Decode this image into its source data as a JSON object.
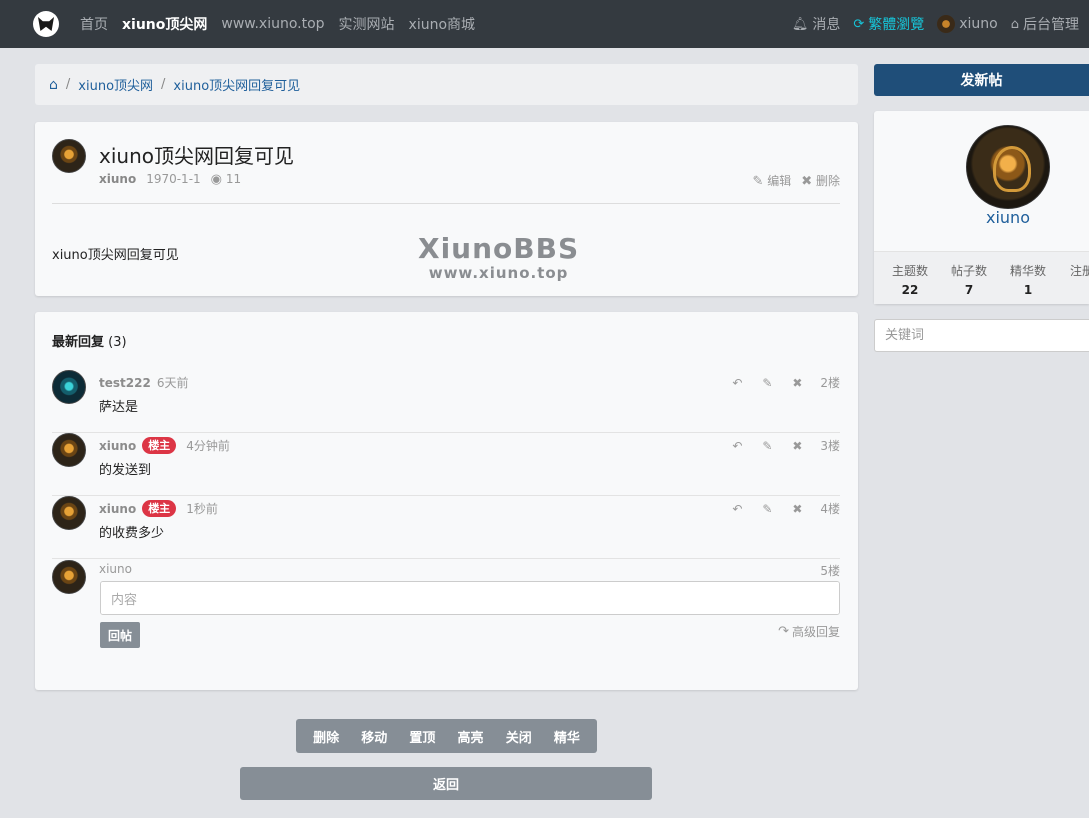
{
  "nav": {
    "left": [
      {
        "label": "首页",
        "active": false
      },
      {
        "label": "xiuno顶尖网",
        "active": true
      },
      {
        "label": "www.xiuno.top",
        "active": false
      },
      {
        "label": "实测网站",
        "active": false
      },
      {
        "label": "xiuno商城",
        "active": false
      }
    ],
    "right": {
      "messages": "消息",
      "traditional": "繁體瀏覽",
      "username": "xiuno",
      "admin": "后台管理"
    },
    "colors": {
      "bar": "#343a40",
      "accent": "#17c4d8"
    }
  },
  "breadcrumb": {
    "items": [
      "xiuno顶尖网",
      "xiuno顶尖网回复可见"
    ]
  },
  "post": {
    "title": "xiuno顶尖网回复可见",
    "author": "xiuno",
    "date": "1970-1-1",
    "views": "11",
    "edit": "编辑",
    "delete": "删除",
    "body": "xiuno顶尖网回复可见",
    "watermark_line1": "XiunoBBS",
    "watermark_line2": "www.xiuno.top"
  },
  "replies": {
    "title": "最新回复",
    "count": "(3)",
    "items": [
      {
        "user": "test222",
        "badge": "",
        "time": "6天前",
        "content": "萨达是",
        "floor": "2楼"
      },
      {
        "user": "xiuno",
        "badge": "楼主",
        "time": "4分钟前",
        "content": "的发送到",
        "floor": "3楼"
      },
      {
        "user": "xiuno",
        "badge": "楼主",
        "time": "1秒前",
        "content": "的收费多少",
        "floor": "4楼"
      }
    ]
  },
  "quick_reply": {
    "user": "xiuno",
    "floor": "5楼",
    "placeholder": "内容",
    "submit": "回帖",
    "advanced": "高级回复"
  },
  "moderation": [
    "删除",
    "移动",
    "置顶",
    "高亮",
    "关闭",
    "精华"
  ],
  "back": "返回",
  "sidebar": {
    "new_post": "发新帖",
    "profile_name": "xiuno",
    "stats": [
      {
        "label": "主题数",
        "value": "22"
      },
      {
        "label": "帖子数",
        "value": "7"
      },
      {
        "label": "精华数",
        "value": "1"
      },
      {
        "label": "注册排名",
        "value": ""
      }
    ],
    "search_placeholder": "关键词"
  }
}
